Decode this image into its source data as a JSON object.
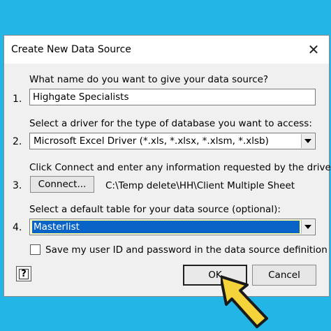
{
  "dialog": {
    "title": "Create New Data Source",
    "close_label": "✕"
  },
  "steps": [
    {
      "number": "1.",
      "prompt": "What name do you want to give your data source?",
      "value": "Highgate Specialists"
    },
    {
      "number": "2.",
      "prompt": "Select a driver for the type of database you want to access:",
      "value": "Microsoft Excel Driver (*.xls, *.xlsx, *.xlsm, *.xlsb)"
    },
    {
      "number": "3.",
      "prompt": "Click Connect and enter any information requested by the driver:",
      "button_label": "Connect...",
      "path": "C:\\Temp delete\\HH\\Client Multiple Sheet"
    },
    {
      "number": "4.",
      "prompt": "Select a default table for your data source (optional):",
      "value": "Masterlist"
    }
  ],
  "save_credentials": {
    "label": "Save my user ID and password in the data source definition",
    "checked": false
  },
  "buttons": {
    "help": "?",
    "ok": "OK",
    "cancel": "Cancel"
  },
  "colors": {
    "background": "#22b5e6",
    "selection": "#0a64c8",
    "pointer_fill": "#f5d33a"
  }
}
